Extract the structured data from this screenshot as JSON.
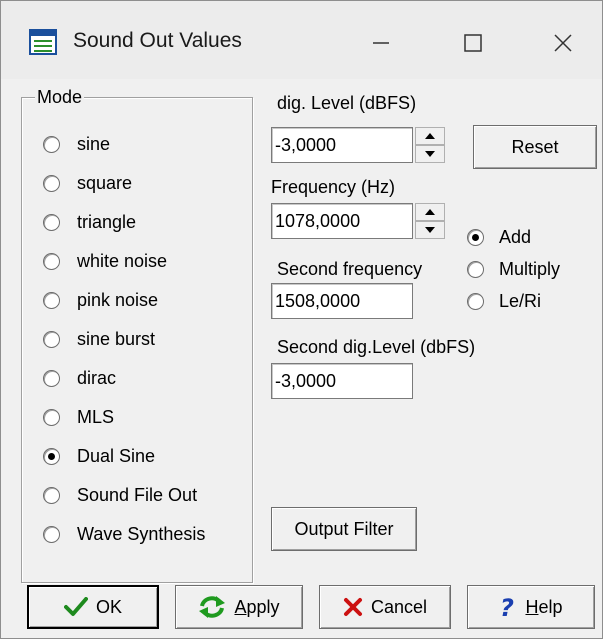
{
  "window": {
    "title": "Sound Out Values",
    "minimize_icon": "minimize-icon",
    "maximize_icon": "maximize-icon",
    "close_icon": "close-icon"
  },
  "mode": {
    "legend": "Mode",
    "options": [
      {
        "label": "sine",
        "checked": false
      },
      {
        "label": "square",
        "checked": false
      },
      {
        "label": "triangle",
        "checked": false
      },
      {
        "label": "white noise",
        "checked": false
      },
      {
        "label": "pink noise",
        "checked": false
      },
      {
        "label": "sine burst",
        "checked": false
      },
      {
        "label": "dirac",
        "checked": false
      },
      {
        "label": "MLS",
        "checked": false
      },
      {
        "label": "Dual Sine",
        "checked": true
      },
      {
        "label": "Sound File Out",
        "checked": false
      },
      {
        "label": "Wave Synthesis",
        "checked": false
      }
    ]
  },
  "fields": {
    "level_label": "dig. Level (dBFS)",
    "level_value": "-3,0000",
    "frequency_label": "Frequency (Hz)",
    "frequency_value": "1078,0000",
    "second_frequency_label": "Second frequency",
    "second_frequency_value": "1508,0000",
    "second_level_label": "Second dig.Level (dbFS)",
    "second_level_value": "-3,0000"
  },
  "combine": {
    "options": [
      {
        "label": "Add",
        "checked": true
      },
      {
        "label": "Multiply",
        "checked": false
      },
      {
        "label": "Le/Ri",
        "checked": false
      }
    ]
  },
  "buttons": {
    "reset": "Reset",
    "output_filter": "Output Filter",
    "ok": "OK",
    "apply_underlined": "A",
    "apply_rest": "pply",
    "cancel": "Cancel",
    "help_underlined": "H",
    "help_rest": "elp"
  },
  "colors": {
    "ok_check": "#1e8a1e",
    "apply_arrows": "#1f9a1f",
    "cancel_x": "#cc1111",
    "help_question": "#1a3fb0"
  }
}
